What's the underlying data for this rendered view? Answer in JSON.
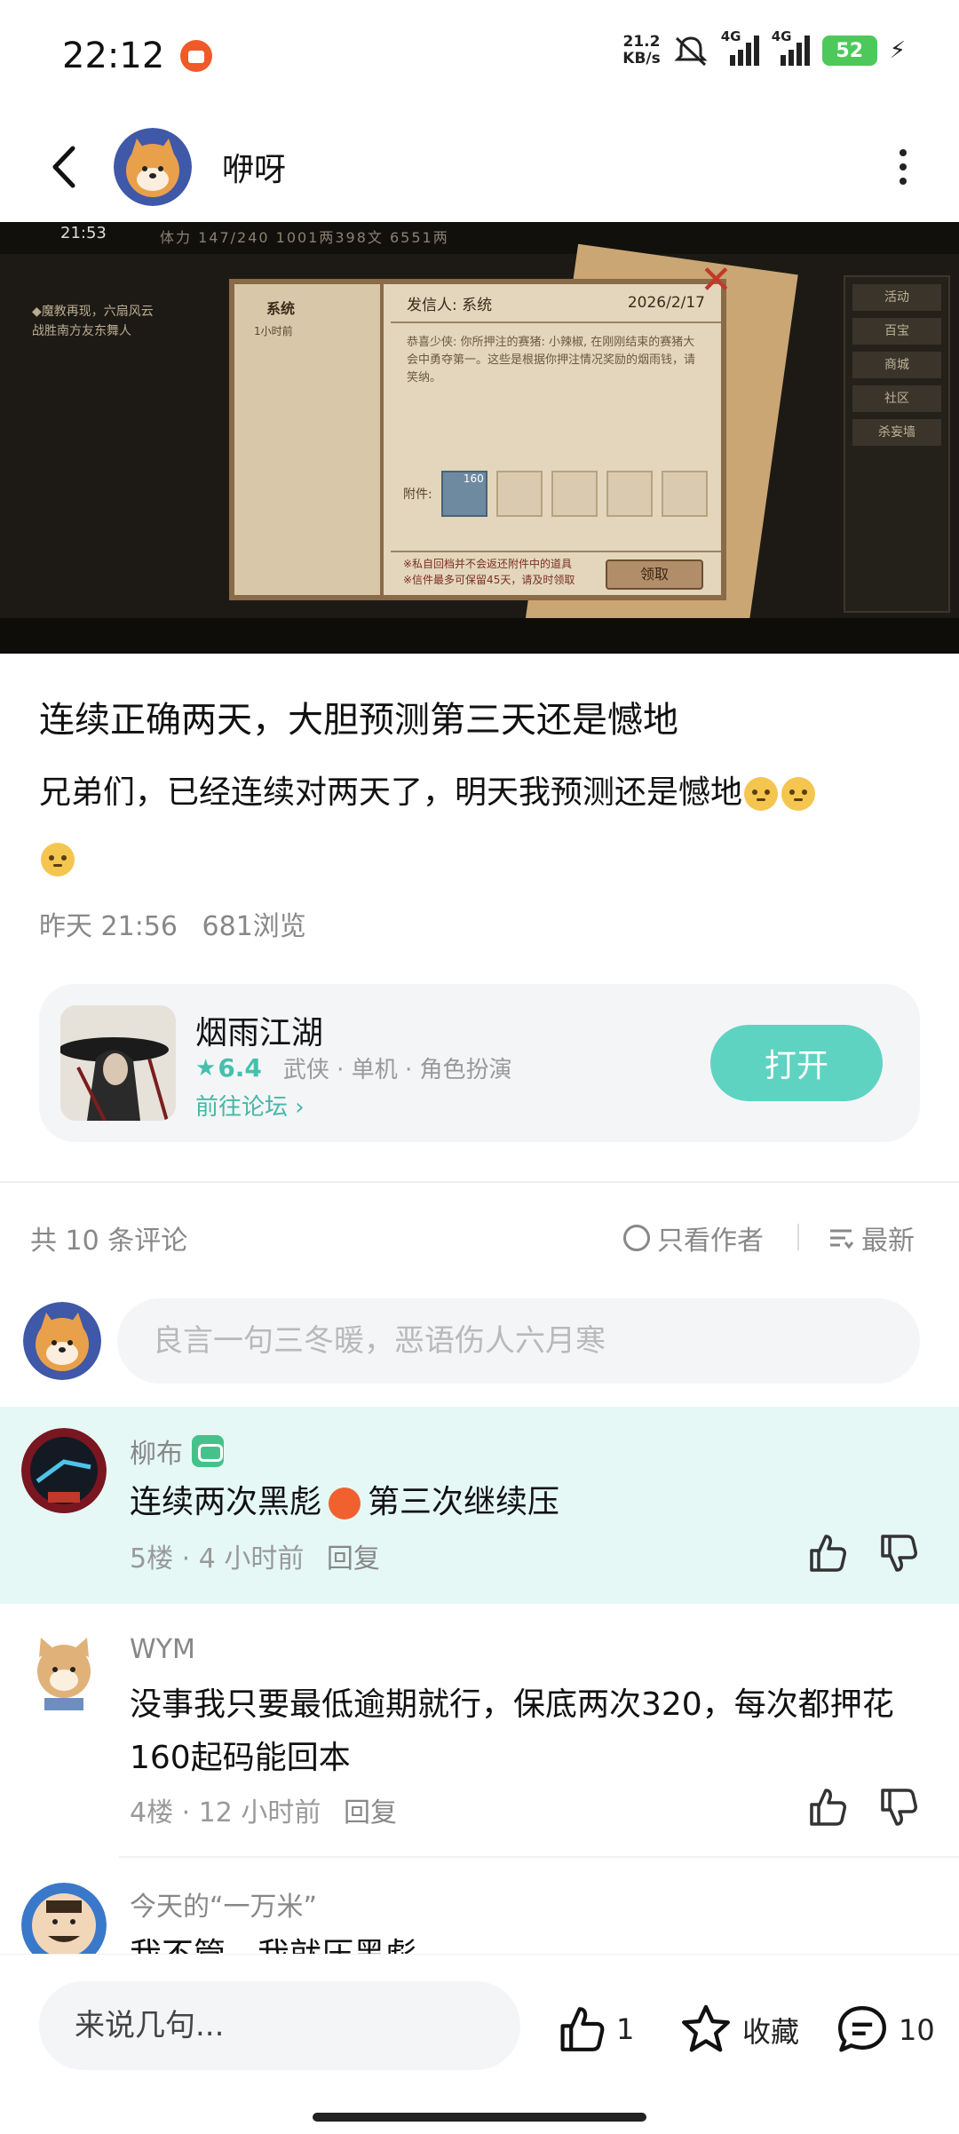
{
  "status_bar": {
    "time": "22:12",
    "net_speed_value": "21.2",
    "net_speed_unit": "KB/s",
    "signal1_label": "4G",
    "signal2_label": "4G",
    "battery_level": "52",
    "icons": [
      "app-notification-icon",
      "mute-icon",
      "signal-icon",
      "signal-icon",
      "battery-icon",
      "charging-icon"
    ]
  },
  "header": {
    "author_name": "咿呀",
    "icons": [
      "back-arrow-icon",
      "avatar",
      "more-vertical-icon"
    ]
  },
  "post_image": {
    "game_time": "21:53",
    "top_values": "体力 147/240   1001两398文   6551两",
    "left_text_line1": "◆魔教再现，六扇风云",
    "left_text_line2": "战胜南方友东舞人",
    "letter_tab": "系统",
    "letter_tab_time": "1小时前",
    "letter_sender": "发信人: 系统",
    "letter_date": "2026/2/17",
    "letter_body": "恭喜少侠: 你所押注的赛猪: 小辣椒, 在刚刚结束的赛猪大会中勇夺第一。这些是根据你押注情况奖励的烟雨钱，请笑纳。",
    "attach_label": "附件:",
    "attach_count": "160",
    "footer_line1": "※私自回档并不会返还附件中的道具",
    "footer_line2": "※信件最多可保留45天，请及时领取",
    "claim_label": "领取",
    "right_panel": [
      "活动",
      "百宝",
      "商城",
      "社区",
      "杀妄墙"
    ]
  },
  "post": {
    "title": "连续正确两天，大胆预测第三天还是憾地",
    "body": "兄弟们，已经连续对两天了，明天我预测还是憾地",
    "date": "昨天 21:56",
    "views": "681浏览"
  },
  "game_card": {
    "name": "烟雨江湖",
    "score": "6.4",
    "tags": "武侠 · 单机 · 角色扮演",
    "forum_link": "前往论坛",
    "open_label": "打开"
  },
  "comments_header": {
    "count_label": "共 10 条评论",
    "author_only_label": "只看作者",
    "sort_label": "最新"
  },
  "comment_input": {
    "placeholder": "良言一句三冬暖，恶语伤人六月寒"
  },
  "comments": [
    {
      "name": "柳布",
      "text_before": "连续两次黑彪",
      "text_after": "第三次继续压",
      "floor": "5楼 · 4 小时前",
      "reply": "回复"
    },
    {
      "name": "WYM",
      "text": "没事我只要最低逾期就行，保底两次320，每次都押花160起码能回本",
      "floor": "4楼 · 12 小时前",
      "reply": "回复"
    },
    {
      "name": "今天的“一万米”",
      "text": "我不管，我就压黑彪"
    }
  ],
  "bottom_bar": {
    "input_placeholder": "来说几句...",
    "like_count": "1",
    "favorite_label": "收藏",
    "comment_count": "10"
  },
  "colors": {
    "accent": "#5fd3c2",
    "accent_text": "#45b8a6",
    "highlight_bg": "#e5f8f6",
    "battery": "#4cc95a"
  }
}
